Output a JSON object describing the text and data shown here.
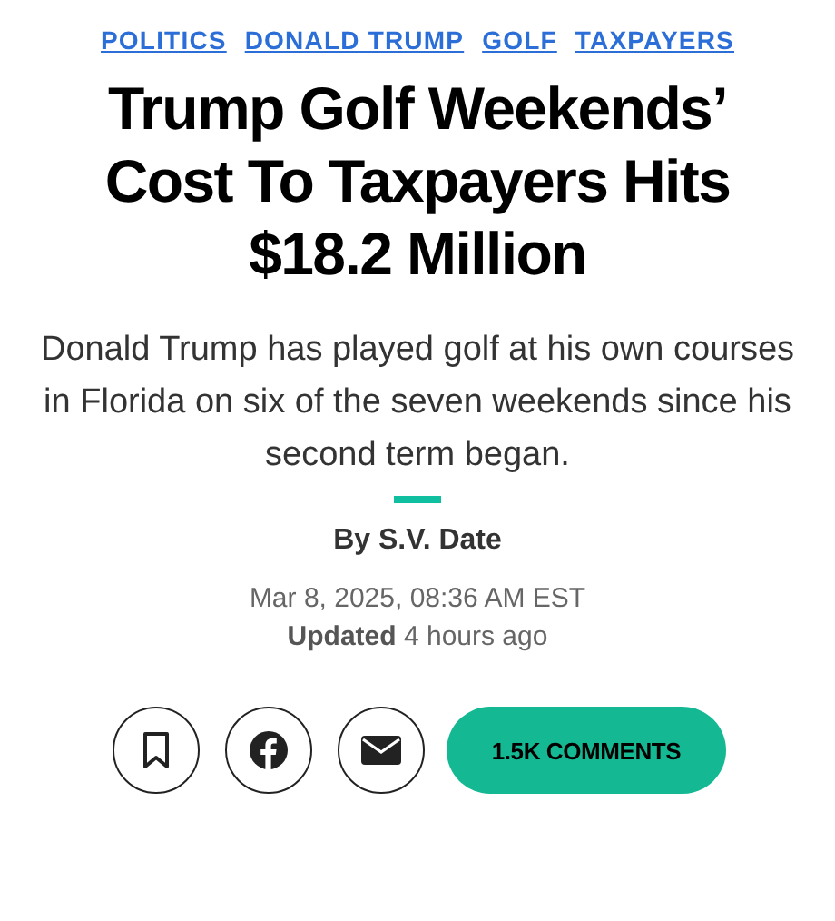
{
  "tags": [
    "POLITICS",
    "DONALD TRUMP",
    "GOLF",
    "TAXPAYERS"
  ],
  "headline": "Trump Golf Weekends’ Cost To Taxpayers Hits $18.2 Million",
  "dek": "Donald Trump has played golf at his own courses in Florida on six of the seven weekends since his second term began.",
  "byline": "By S.V. Date",
  "published": "Mar 8, 2025, 08:36 AM EST",
  "updated": "**Updated** 4 hours ago",
  "comments_button": "1.5K COMMENTS"
}
